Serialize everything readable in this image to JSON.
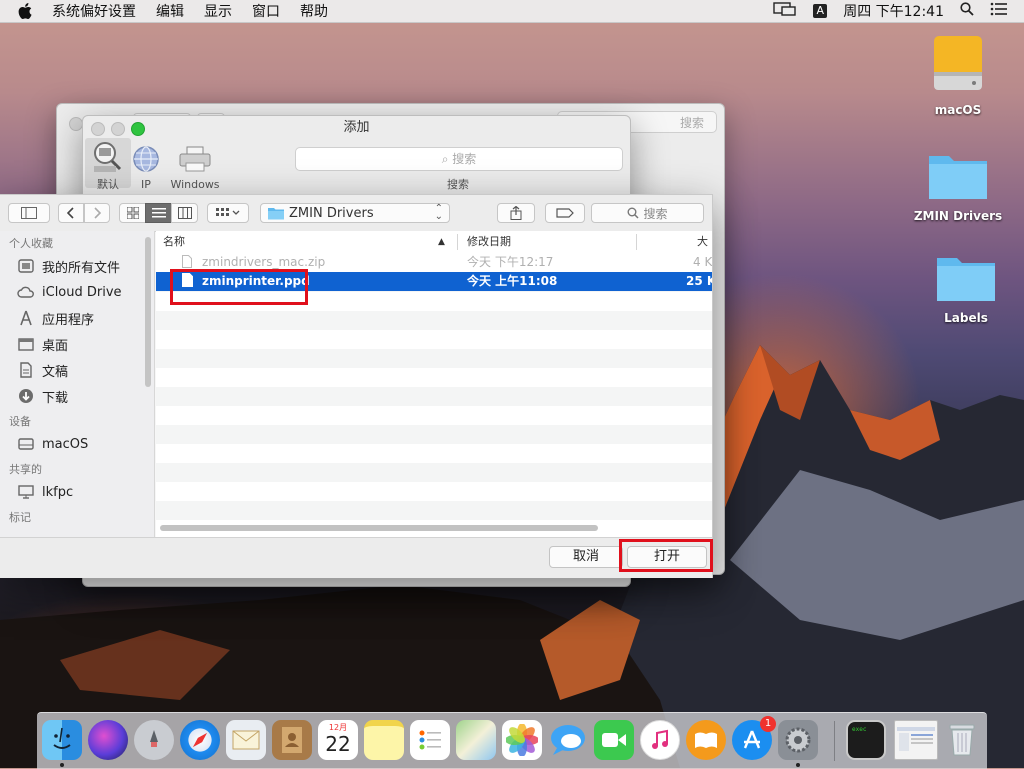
{
  "menubar": {
    "app_name": "系统偏好设置",
    "items": [
      "编辑",
      "显示",
      "窗口",
      "帮助"
    ],
    "input_source": "A",
    "clock": "周四 下午12:41"
  },
  "desktop": {
    "icons": [
      {
        "label": "macOS"
      },
      {
        "label": "ZMIN Drivers"
      },
      {
        "label": "Labels"
      }
    ]
  },
  "back_window": {
    "search_placeholder": "搜索"
  },
  "add_window": {
    "title": "添加",
    "toolbar": [
      {
        "label": "默认"
      },
      {
        "label": "IP"
      },
      {
        "label": "Windows"
      }
    ],
    "search_placeholder": "搜索",
    "search_label": "搜索"
  },
  "open_panel": {
    "path": "ZMIN Drivers",
    "search_placeholder": "搜索",
    "sidebar": {
      "favorites_header": "个人收藏",
      "favorites": [
        "我的所有文件",
        "iCloud Drive",
        "应用程序",
        "桌面",
        "文稿",
        "下载"
      ],
      "devices_header": "设备",
      "devices": [
        "macOS"
      ],
      "shared_header": "共享的",
      "shared": [
        "lkfpc"
      ],
      "tags_header": "标记"
    },
    "columns": {
      "name": "名称",
      "date": "修改日期",
      "size": "大小"
    },
    "files": [
      {
        "name": "zmindrivers_mac.zip",
        "date": "今天 下午12:17",
        "size": "4 K",
        "state": "dim"
      },
      {
        "name": "zminprinter.ppd",
        "date": "今天 上午11:08",
        "size": "25 K",
        "state": "selected"
      }
    ],
    "cancel_label": "取消",
    "open_label": "打开"
  },
  "dock": {
    "apps": [
      "Finder",
      "Siri",
      "Launchpad",
      "Safari",
      "Mail",
      "Contacts",
      "Calendar",
      "Notes",
      "Reminders",
      "Maps",
      "Photos",
      "Messages",
      "FaceTime",
      "iTunes",
      "iBooks",
      "App Store",
      "System Preferences",
      "Terminal",
      "Preview",
      "Trash"
    ],
    "calendar_month": "12月",
    "calendar_day": "22",
    "appstore_badge": "1",
    "terminal_text": "exec"
  },
  "colors": {
    "selection": "#0f62d1",
    "highlight_box": "#e0101c"
  }
}
